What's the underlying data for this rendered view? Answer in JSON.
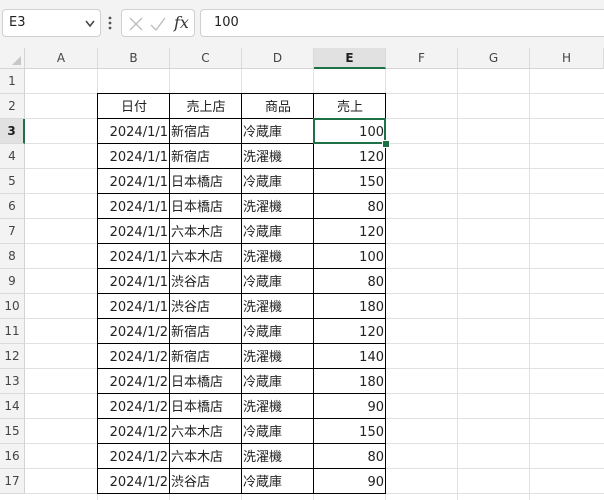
{
  "formula_bar": {
    "name_box": "E3",
    "fx_label": "fx",
    "formula_value": "100"
  },
  "columns": [
    "A",
    "B",
    "C",
    "D",
    "E",
    "F",
    "G",
    "H"
  ],
  "selected_column": "E",
  "selected_row": 3,
  "table": {
    "headers": [
      "日付",
      "売上店",
      "商品",
      "売上"
    ],
    "rows": [
      [
        "2024/1/1",
        "新宿店",
        "冷蔵庫",
        "100"
      ],
      [
        "2024/1/1",
        "新宿店",
        "洗濯機",
        "120"
      ],
      [
        "2024/1/1",
        "日本橋店",
        "冷蔵庫",
        "150"
      ],
      [
        "2024/1/1",
        "日本橋店",
        "洗濯機",
        "80"
      ],
      [
        "2024/1/1",
        "六本木店",
        "冷蔵庫",
        "120"
      ],
      [
        "2024/1/1",
        "六本木店",
        "洗濯機",
        "100"
      ],
      [
        "2024/1/1",
        "渋谷店",
        "冷蔵庫",
        "80"
      ],
      [
        "2024/1/1",
        "渋谷店",
        "洗濯機",
        "180"
      ],
      [
        "2024/1/2",
        "新宿店",
        "冷蔵庫",
        "120"
      ],
      [
        "2024/1/2",
        "新宿店",
        "洗濯機",
        "140"
      ],
      [
        "2024/1/2",
        "日本橋店",
        "冷蔵庫",
        "180"
      ],
      [
        "2024/1/2",
        "日本橋店",
        "洗濯機",
        "90"
      ],
      [
        "2024/1/2",
        "六本木店",
        "冷蔵庫",
        "150"
      ],
      [
        "2024/1/2",
        "六本木店",
        "洗濯機",
        "80"
      ],
      [
        "2024/1/2",
        "渋谷店",
        "冷蔵庫",
        "90"
      ]
    ]
  },
  "row_numbers": [
    "1",
    "2",
    "3",
    "4",
    "5",
    "6",
    "7",
    "8",
    "9",
    "10",
    "11",
    "12",
    "13",
    "14",
    "15",
    "16",
    "17"
  ],
  "colors": {
    "selection_accent": "#1e7145",
    "header_bg": "#f3f3f3"
  }
}
